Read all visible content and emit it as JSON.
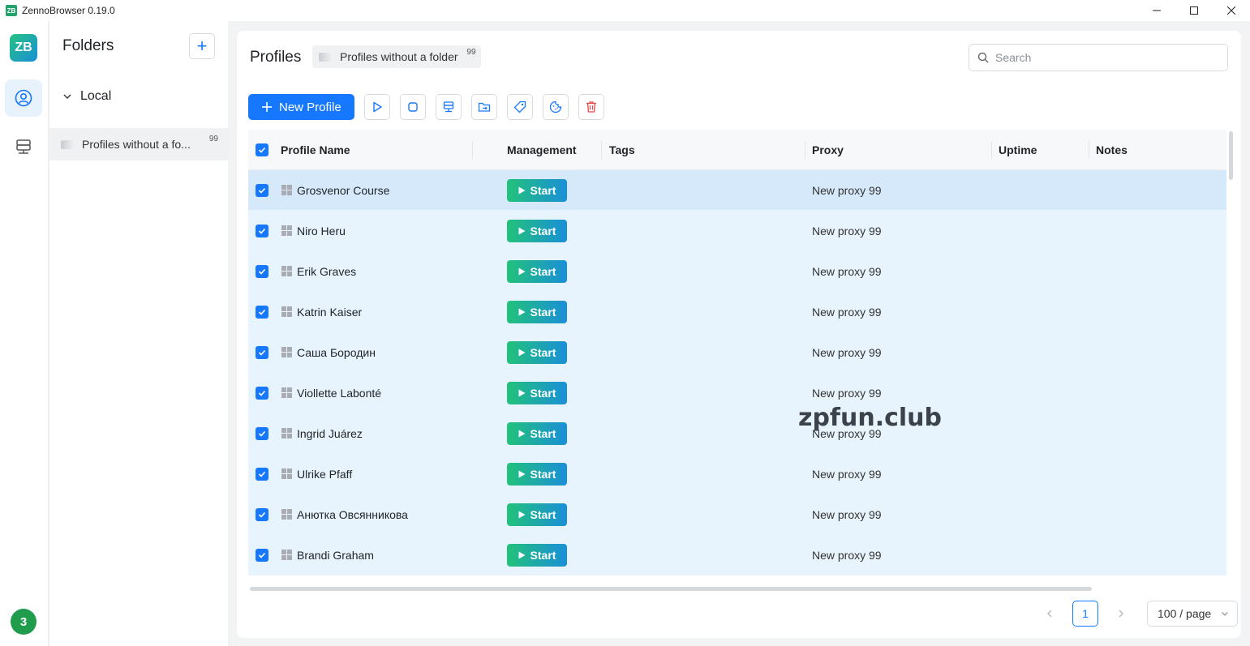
{
  "window": {
    "title": "ZennoBrowser 0.19.0",
    "icon_text": "ZB"
  },
  "rail": {
    "logo_text": "ZB",
    "notification_count": "3"
  },
  "folders": {
    "title": "Folders",
    "add_symbol": "+",
    "group_label": "Local",
    "items": [
      {
        "label": "Profiles without a fo...",
        "count": "99"
      }
    ]
  },
  "main": {
    "title": "Profiles",
    "folder_chip": {
      "label": "Profiles without a folder",
      "count": "99"
    },
    "search": {
      "placeholder": "Search",
      "value": ""
    },
    "new_profile_label": "New Profile"
  },
  "table": {
    "columns": {
      "name": "Profile Name",
      "management": "Management",
      "tags": "Tags",
      "proxy": "Proxy",
      "uptime": "Uptime",
      "notes": "Notes"
    },
    "start_label": "Start",
    "rows": [
      {
        "name": "Grosvenor Course",
        "proxy": "New proxy 99"
      },
      {
        "name": "Niro Heru",
        "proxy": "New proxy 99"
      },
      {
        "name": "Erik Graves",
        "proxy": "New proxy 99"
      },
      {
        "name": "Katrin Kaiser",
        "proxy": "New proxy 99"
      },
      {
        "name": "Саша Бородин",
        "proxy": "New proxy 99"
      },
      {
        "name": "Viollette Labonté",
        "proxy": "New proxy 99"
      },
      {
        "name": "Ingrid Juárez",
        "proxy": "New proxy 99"
      },
      {
        "name": "Ulrike Pfaff",
        "proxy": "New proxy 99"
      },
      {
        "name": "Анютка Овсянникова",
        "proxy": "New proxy 99"
      },
      {
        "name": "Brandi Graham",
        "proxy": "New proxy 99"
      }
    ]
  },
  "watermark": "zpfun.club",
  "pagination": {
    "current_page": "1",
    "page_size": "100 / page"
  },
  "colors": {
    "accent": "#1677ff",
    "start_gradient_from": "#22c27a",
    "start_gradient_to": "#1a8fd8",
    "row_selected": "#e7f3fd",
    "delete": "#e5484d"
  }
}
